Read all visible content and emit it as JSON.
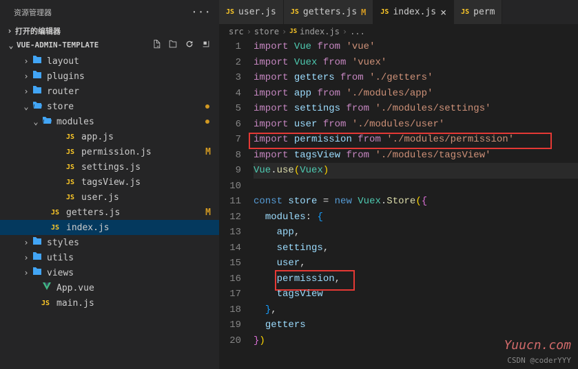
{
  "explorer": {
    "title": "资源管理器",
    "open_editors": "打开的编辑器",
    "project_name": "VUE-ADMIN-TEMPLATE",
    "tree": [
      {
        "type": "folder",
        "label": "layout",
        "depth": 1,
        "open": false,
        "chevron": true
      },
      {
        "type": "folder",
        "label": "plugins",
        "depth": 1,
        "open": false,
        "chevron": true
      },
      {
        "type": "folder",
        "label": "router",
        "depth": 1,
        "open": false,
        "chevron": true
      },
      {
        "type": "folder",
        "label": "store",
        "depth": 1,
        "open": true,
        "chevron": true,
        "dot": true
      },
      {
        "type": "folder",
        "label": "modules",
        "depth": 2,
        "open": true,
        "chevron": true,
        "dot": true
      },
      {
        "type": "js",
        "label": "app.js",
        "depth": 4
      },
      {
        "type": "js",
        "label": "permission.js",
        "depth": 4,
        "badge": "M"
      },
      {
        "type": "js",
        "label": "settings.js",
        "depth": 4
      },
      {
        "type": "js",
        "label": "tagsView.js",
        "depth": 4
      },
      {
        "type": "js",
        "label": "user.js",
        "depth": 4
      },
      {
        "type": "js",
        "label": "getters.js",
        "depth": 3,
        "badge": "M"
      },
      {
        "type": "js",
        "label": "index.js",
        "depth": 3,
        "selected": true
      },
      {
        "type": "folder",
        "label": "styles",
        "depth": 1,
        "open": false,
        "chevron": true
      },
      {
        "type": "folder",
        "label": "utils",
        "depth": 1,
        "open": false,
        "chevron": true
      },
      {
        "type": "folder",
        "label": "views",
        "depth": 1,
        "open": false,
        "chevron": true
      },
      {
        "type": "vue",
        "label": "App.vue",
        "depth": 2
      },
      {
        "type": "js",
        "label": "main.js",
        "depth": 2
      }
    ]
  },
  "tabs": [
    {
      "icon": "js",
      "label": "user.js",
      "active": false
    },
    {
      "icon": "js",
      "label": "getters.js",
      "active": false,
      "badge": "M"
    },
    {
      "icon": "js",
      "label": "index.js",
      "active": true,
      "close": true
    },
    {
      "icon": "js",
      "label": "perm",
      "active": false,
      "truncated": true
    }
  ],
  "breadcrumb": [
    "src",
    "store",
    "index.js",
    "..."
  ],
  "code": {
    "lines": [
      [
        {
          "t": "kw",
          "v": "import"
        },
        {
          "t": "sp",
          "v": " "
        },
        {
          "t": "type",
          "v": "Vue"
        },
        {
          "t": "sp",
          "v": " "
        },
        {
          "t": "kw",
          "v": "from"
        },
        {
          "t": "sp",
          "v": " "
        },
        {
          "t": "str",
          "v": "'vue'"
        }
      ],
      [
        {
          "t": "kw",
          "v": "import"
        },
        {
          "t": "sp",
          "v": " "
        },
        {
          "t": "type",
          "v": "Vuex"
        },
        {
          "t": "sp",
          "v": " "
        },
        {
          "t": "kw",
          "v": "from"
        },
        {
          "t": "sp",
          "v": " "
        },
        {
          "t": "str",
          "v": "'vuex'"
        }
      ],
      [
        {
          "t": "kw",
          "v": "import"
        },
        {
          "t": "sp",
          "v": " "
        },
        {
          "t": "var",
          "v": "getters"
        },
        {
          "t": "sp",
          "v": " "
        },
        {
          "t": "kw",
          "v": "from"
        },
        {
          "t": "sp",
          "v": " "
        },
        {
          "t": "str",
          "v": "'./getters'"
        }
      ],
      [
        {
          "t": "kw",
          "v": "import"
        },
        {
          "t": "sp",
          "v": " "
        },
        {
          "t": "var",
          "v": "app"
        },
        {
          "t": "sp",
          "v": " "
        },
        {
          "t": "kw",
          "v": "from"
        },
        {
          "t": "sp",
          "v": " "
        },
        {
          "t": "str",
          "v": "'./modules/app'"
        }
      ],
      [
        {
          "t": "kw",
          "v": "import"
        },
        {
          "t": "sp",
          "v": " "
        },
        {
          "t": "var",
          "v": "settings"
        },
        {
          "t": "sp",
          "v": " "
        },
        {
          "t": "kw",
          "v": "from"
        },
        {
          "t": "sp",
          "v": " "
        },
        {
          "t": "str",
          "v": "'./modules/settings'"
        }
      ],
      [
        {
          "t": "kw",
          "v": "import"
        },
        {
          "t": "sp",
          "v": " "
        },
        {
          "t": "var",
          "v": "user"
        },
        {
          "t": "sp",
          "v": " "
        },
        {
          "t": "kw",
          "v": "from"
        },
        {
          "t": "sp",
          "v": " "
        },
        {
          "t": "str",
          "v": "'./modules/user'"
        }
      ],
      [
        {
          "t": "kw",
          "v": "import"
        },
        {
          "t": "sp",
          "v": " "
        },
        {
          "t": "var",
          "v": "permission"
        },
        {
          "t": "sp",
          "v": " "
        },
        {
          "t": "kw",
          "v": "from"
        },
        {
          "t": "sp",
          "v": " "
        },
        {
          "t": "str",
          "v": "'./modules/permission'"
        }
      ],
      [
        {
          "t": "kw",
          "v": "import"
        },
        {
          "t": "sp",
          "v": " "
        },
        {
          "t": "var",
          "v": "tagsView"
        },
        {
          "t": "sp",
          "v": " "
        },
        {
          "t": "kw",
          "v": "from"
        },
        {
          "t": "sp",
          "v": " "
        },
        {
          "t": "str",
          "v": "'./modules/tagsView'"
        }
      ],
      [
        {
          "t": "type",
          "v": "Vue"
        },
        {
          "t": "punct",
          "v": "."
        },
        {
          "t": "fn",
          "v": "use"
        },
        {
          "t": "paren",
          "v": "("
        },
        {
          "t": "type",
          "v": "Vuex"
        },
        {
          "t": "paren",
          "v": ")"
        }
      ],
      [],
      [
        {
          "t": "const",
          "v": "const"
        },
        {
          "t": "sp",
          "v": " "
        },
        {
          "t": "var",
          "v": "store"
        },
        {
          "t": "sp",
          "v": " "
        },
        {
          "t": "punct",
          "v": "="
        },
        {
          "t": "sp",
          "v": " "
        },
        {
          "t": "const",
          "v": "new"
        },
        {
          "t": "sp",
          "v": " "
        },
        {
          "t": "type",
          "v": "Vuex"
        },
        {
          "t": "punct",
          "v": "."
        },
        {
          "t": "fn",
          "v": "Store"
        },
        {
          "t": "paren",
          "v": "("
        },
        {
          "t": "brace-p",
          "v": "{"
        }
      ],
      [
        {
          "t": "sp",
          "v": "  "
        },
        {
          "t": "prop",
          "v": "modules"
        },
        {
          "t": "punct",
          "v": ": "
        },
        {
          "t": "brace-b",
          "v": "{"
        }
      ],
      [
        {
          "t": "sp",
          "v": "    "
        },
        {
          "t": "var",
          "v": "app"
        },
        {
          "t": "punct",
          "v": ","
        }
      ],
      [
        {
          "t": "sp",
          "v": "    "
        },
        {
          "t": "var",
          "v": "settings"
        },
        {
          "t": "punct",
          "v": ","
        }
      ],
      [
        {
          "t": "sp",
          "v": "    "
        },
        {
          "t": "var",
          "v": "user"
        },
        {
          "t": "punct",
          "v": ","
        }
      ],
      [
        {
          "t": "sp",
          "v": "    "
        },
        {
          "t": "var",
          "v": "permission"
        },
        {
          "t": "punct",
          "v": ","
        }
      ],
      [
        {
          "t": "sp",
          "v": "    "
        },
        {
          "t": "var",
          "v": "tagsView"
        }
      ],
      [
        {
          "t": "sp",
          "v": "  "
        },
        {
          "t": "brace-b",
          "v": "}"
        },
        {
          "t": "punct",
          "v": ","
        }
      ],
      [
        {
          "t": "sp",
          "v": "  "
        },
        {
          "t": "var",
          "v": "getters"
        }
      ],
      [
        {
          "t": "brace-p",
          "v": "}"
        },
        {
          "t": "paren",
          "v": ")"
        }
      ]
    ],
    "active_line": 9
  },
  "watermark": "Yuucn.com",
  "credit": "CSDN @coderYYY"
}
